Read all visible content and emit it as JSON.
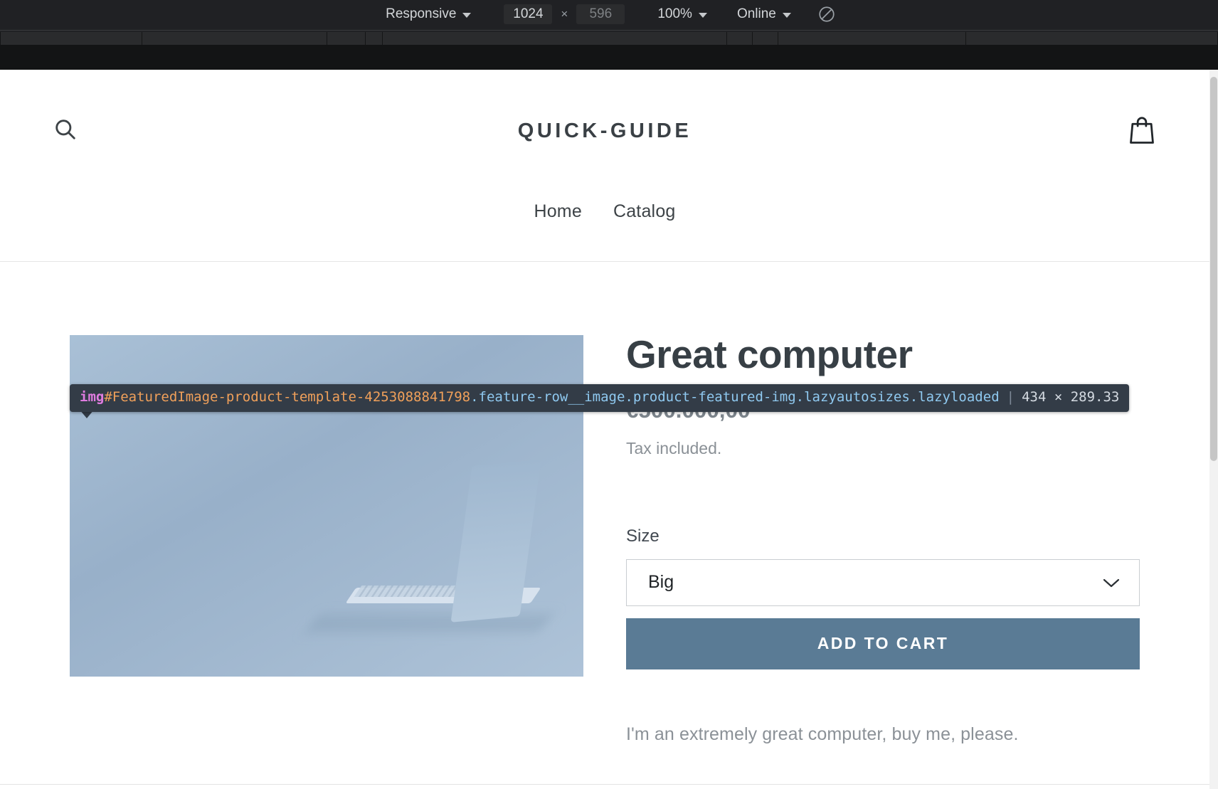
{
  "devtools": {
    "device_mode": {
      "device_label": "Responsive",
      "width_value": "1024",
      "times_symbol": "×",
      "height_value": "596",
      "zoom_label": "100%",
      "throttling_label": "Online",
      "rotate_icon": "rotate-device-icon"
    },
    "inspector_tooltip": {
      "tag": "img",
      "id": "#FeaturedImage-product-template-4253088841798",
      "classes": ".feature-row__image.product-featured-img.lazyautosizes.lazyloaded",
      "divider": "|",
      "dimensions": "434 × 289.33"
    }
  },
  "site": {
    "header": {
      "search_icon": "search-icon",
      "logo": "QUICK-GUIDE",
      "cart_icon": "shopping-bag-icon",
      "nav": [
        {
          "label": "Home"
        },
        {
          "label": "Catalog"
        }
      ]
    },
    "product": {
      "image_alt": "great-computer-laptop-photo",
      "title": "Great computer",
      "price": "€500.000,00",
      "tax_note": "Tax included.",
      "option_label": "Size",
      "option_value": "Big",
      "option_choices": [
        "Big"
      ],
      "add_to_cart_label": "ADD TO CART",
      "description": "I'm an extremely great computer, buy me, please."
    }
  },
  "colors": {
    "add_to_cart_bg": "#5a7b95",
    "logo_text": "#3a4045",
    "price_text": "#7d858c",
    "tooltip_bg": "#333c47",
    "toolbar_bg": "#202124"
  }
}
